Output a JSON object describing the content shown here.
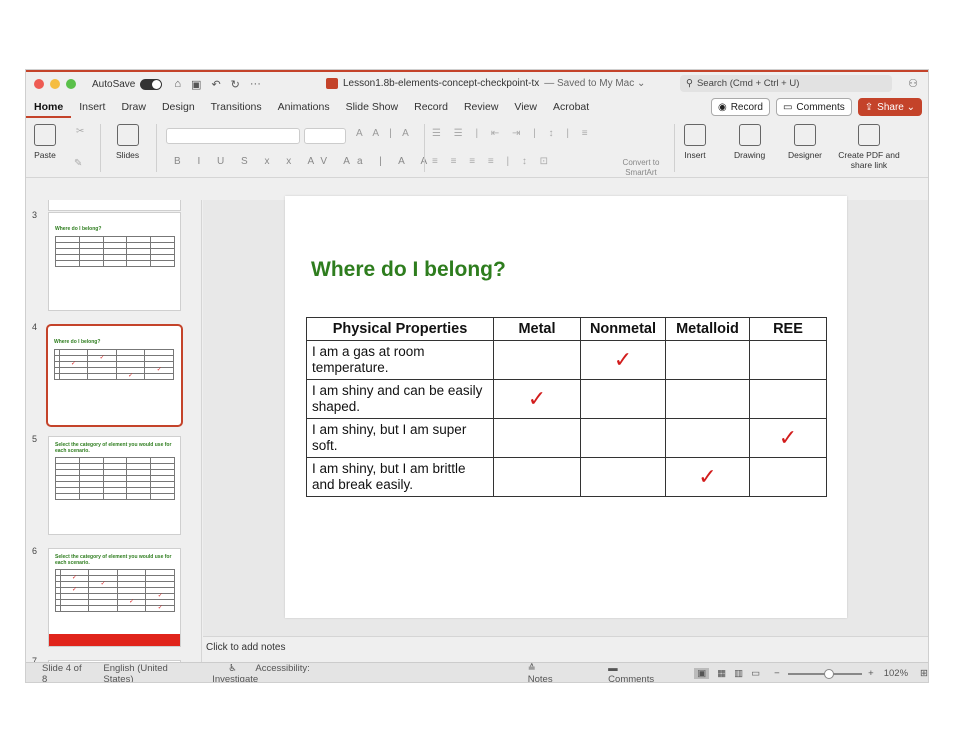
{
  "window": {
    "autosave_label": "AutoSave",
    "document_title": "Lesson1.8b-elements-concept-checkpoint-tx",
    "saved_status": "— Saved to My Mac ⌄",
    "search_placeholder": "Search (Cmd + Ctrl + U)",
    "traffic_colors": [
      "#ee5b53",
      "#f5bd41",
      "#5ac04a"
    ]
  },
  "tabs": [
    "Home",
    "Insert",
    "Draw",
    "Design",
    "Transitions",
    "Animations",
    "Slide Show",
    "Record",
    "Review",
    "View",
    "Acrobat"
  ],
  "tab_actions": {
    "record": "Record",
    "comments": "Comments",
    "share": "Share ⌄"
  },
  "ribbon": {
    "paste": "Paste",
    "slides": "Slides",
    "convert_smartart": "Convert to SmartArt",
    "insert": "Insert",
    "drawing": "Drawing",
    "designer": "Designer",
    "create_pdf": "Create PDF and share link"
  },
  "thumbnails": {
    "numbers": [
      "3",
      "4",
      "5",
      "6",
      "7"
    ],
    "slide3_title": "Where do I belong?",
    "slide4_title": "Where do I belong?",
    "slide5_title": "Select the category of element you would use for each scenario.",
    "slide6_title": "Select the category of element you would use for each scenario."
  },
  "slide": {
    "title": "Where do I belong?",
    "headers": [
      "Physical Properties",
      "Metal",
      "Nonmetal",
      "Metalloid",
      "REE"
    ],
    "rows": [
      {
        "text": "I am a gas at room temperature.",
        "checked": 2
      },
      {
        "text": "I am shiny and can be easily shaped.",
        "checked": 1
      },
      {
        "text": "I am shiny, but I am super soft.",
        "checked": 4
      },
      {
        "text": "I am shiny, but I am brittle and break easily.",
        "checked": 3
      }
    ],
    "check_glyph": "✓"
  },
  "notes_placeholder": "Click to add notes",
  "status": {
    "slide_indicator": "Slide 4 of 8",
    "language": "English (United States)",
    "accessibility": "Accessibility: Investigate",
    "notes": "Notes",
    "comments": "Comments",
    "zoom": "102%"
  }
}
